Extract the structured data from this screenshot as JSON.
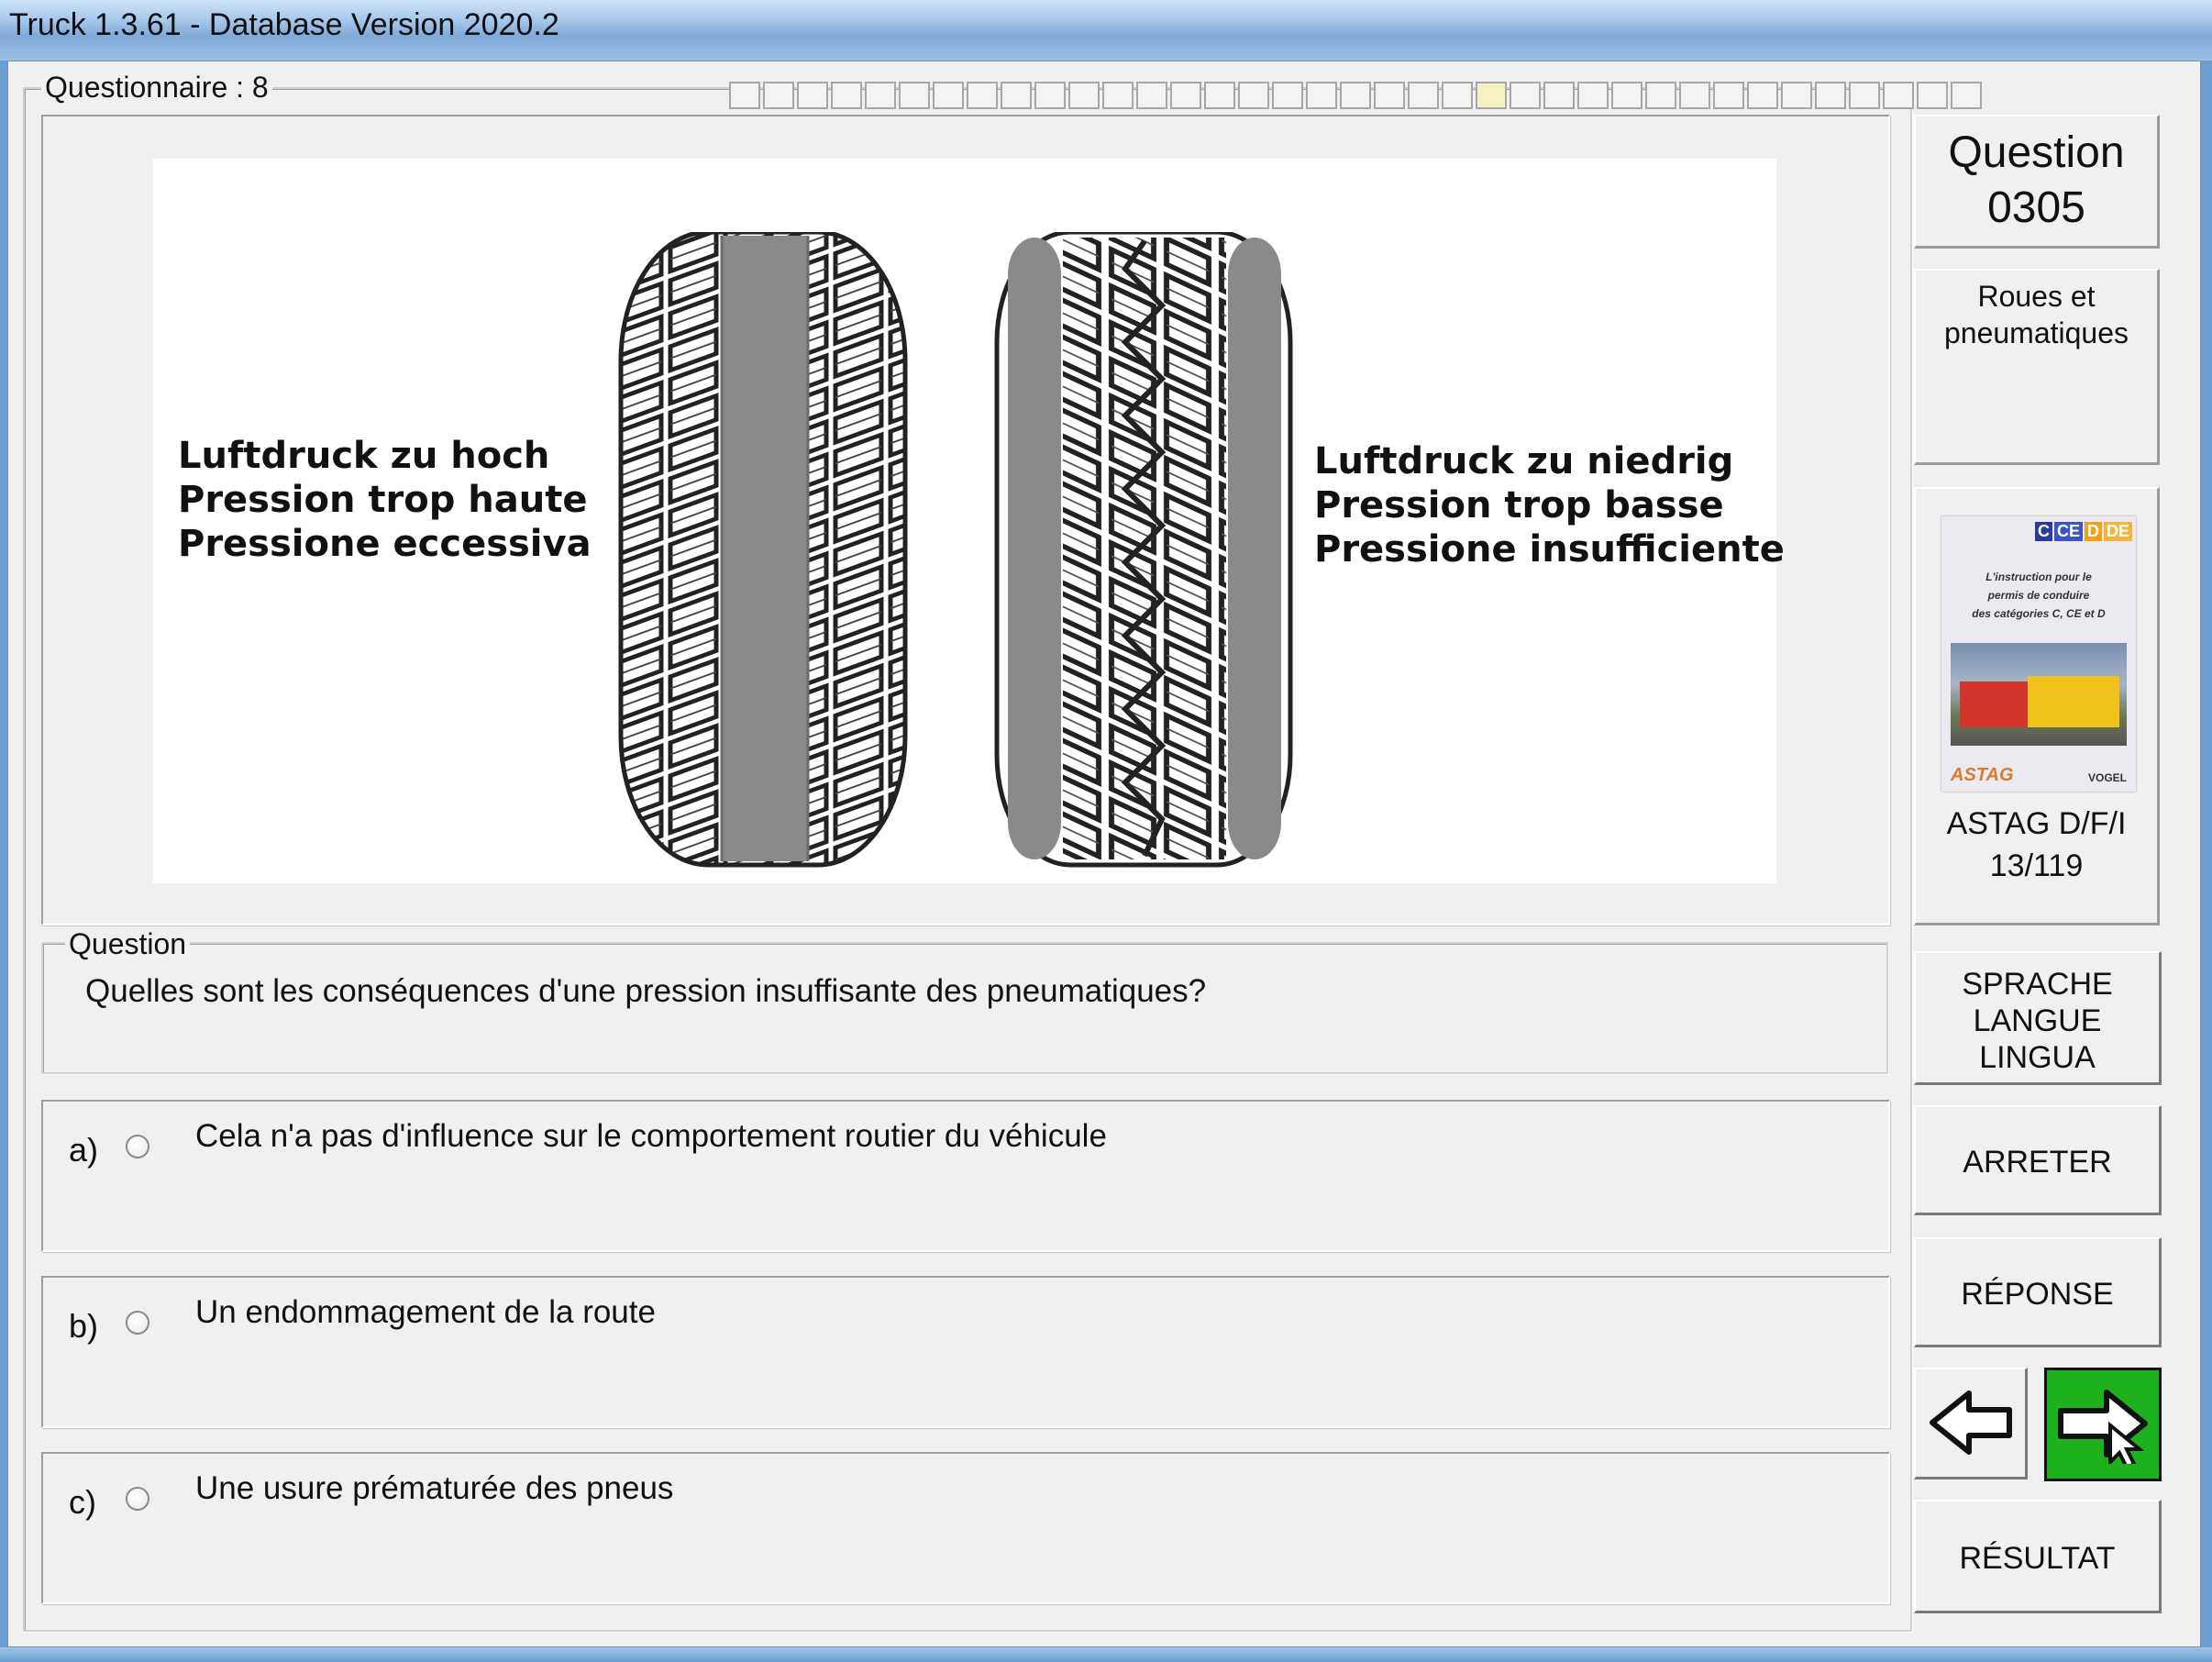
{
  "window": {
    "title": "Truck 1.3.61 - Database Version 2020.2"
  },
  "questionnaire": {
    "label": "Questionnaire : 8",
    "progress_total": 37,
    "progress_current": 22
  },
  "image": {
    "left_label": [
      "Luftdruck zu hoch",
      "Pression trop haute",
      "Pressione eccessiva"
    ],
    "right_label": [
      "Luftdruck zu niedrig",
      "Pression trop basse",
      "Pressione insufficiente"
    ]
  },
  "question": {
    "legend": "Question",
    "text": "Quelles sont les conséquences d'une pression insuffisante des pneumatiques?"
  },
  "answers": [
    {
      "letter": "a)",
      "text": "Cela n'a pas d'influence sur le comportement routier du véhicule"
    },
    {
      "letter": "b)",
      "text": "Un endommagement de la route"
    },
    {
      "letter": "c)",
      "text": "Une usure prématurée des pneus"
    }
  ],
  "sidebar": {
    "question_label": "Question",
    "question_number": "0305",
    "category_line1": "Roues et",
    "category_line2": "pneumatiques",
    "book": {
      "badges": [
        "C",
        "CE",
        "D",
        "DE"
      ],
      "text_lines": [
        "L'instruction pour le",
        "permis de conduire",
        "des catégories C, CE et D"
      ],
      "logo_left": "ASTAG",
      "logo_right": "VOGEL",
      "source_line1": "ASTAG D/F/I",
      "source_line2": "13/119"
    },
    "language_lines": [
      "SPRACHE",
      "LANGUE",
      "LINGUA"
    ],
    "stop_label": "ARRETER",
    "answer_label": "RÉPONSE",
    "result_label": "RÉSULTAT"
  },
  "colors": {
    "next_button": "#1db11d",
    "frame_bg": "#f0f0f0",
    "tire_center": "#8a8a8a"
  }
}
